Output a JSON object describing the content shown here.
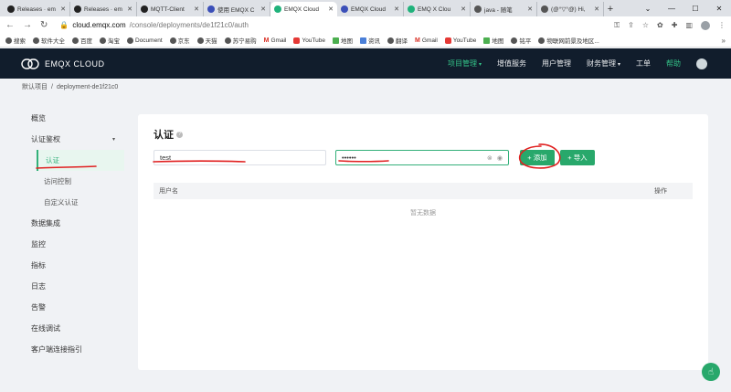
{
  "browser": {
    "tabs": [
      {
        "title": "Releases · em",
        "icon": "github-icon",
        "color": "#222222"
      },
      {
        "title": "Releases · em",
        "icon": "github-icon",
        "color": "#222222"
      },
      {
        "title": "MQTT-Client",
        "icon": "github-icon",
        "color": "#222222"
      },
      {
        "title": "使用 EMQX C",
        "icon": "document-icon",
        "color": "#3b4fb8"
      },
      {
        "title": "EMQX Cloud",
        "icon": "emqx-icon",
        "color": "#20b27b",
        "active": true
      },
      {
        "title": "EMQX Cloud",
        "icon": "document-icon",
        "color": "#3b4fb8"
      },
      {
        "title": "EMQ X Clou",
        "icon": "emqx-icon",
        "color": "#20b27b"
      },
      {
        "title": "java - 随笔",
        "icon": "blog-icon",
        "color": "#555555"
      },
      {
        "title": "(@°▽°@) Hi,",
        "icon": "blog-icon",
        "color": "#555555"
      }
    ],
    "close_glyph": "✕",
    "new_tab_glyph": "+",
    "url_domain": "cloud.emqx.com",
    "url_path": "/console/deployments/de1f21c0/auth",
    "bookmarks": [
      {
        "label": "搜索",
        "kind": "globe"
      },
      {
        "label": "软件大全",
        "kind": "globe"
      },
      {
        "label": "百度",
        "kind": "globe"
      },
      {
        "label": "淘宝",
        "kind": "globe"
      },
      {
        "label": "Document",
        "kind": "globe"
      },
      {
        "label": "京东",
        "kind": "globe"
      },
      {
        "label": "天猫",
        "kind": "globe"
      },
      {
        "label": "苏宁易购",
        "kind": "globe"
      },
      {
        "label": "Gmail",
        "kind": "gmail"
      },
      {
        "label": "YouTube",
        "kind": "youtube"
      },
      {
        "label": "地图",
        "kind": "map"
      },
      {
        "label": "资讯",
        "kind": "blue"
      },
      {
        "label": "翻译",
        "kind": "globe"
      },
      {
        "label": "Gmail",
        "kind": "gmail"
      },
      {
        "label": "YouTube",
        "kind": "youtube"
      },
      {
        "label": "地图",
        "kind": "map"
      },
      {
        "label": "铭平",
        "kind": "globe"
      },
      {
        "label": "物联网前景及地区...",
        "kind": "globe"
      }
    ]
  },
  "app": {
    "logo_text": "EMQX CLOUD",
    "nav": [
      {
        "label": "项目管理",
        "dropdown": true,
        "active": true
      },
      {
        "label": "增值服务",
        "dropdown": false
      },
      {
        "label": "用户管理",
        "dropdown": false
      },
      {
        "label": "财务管理",
        "dropdown": true
      },
      {
        "label": "工单",
        "dropdown": false
      },
      {
        "label": "帮助",
        "dropdown": false,
        "help": true
      }
    ],
    "breadcrumb": {
      "project": "默认项目",
      "separator": "/",
      "deployment": "deployment-de1f21c0"
    },
    "accent_color": "#28a86b"
  },
  "sidebar": {
    "items": [
      {
        "label": "概览",
        "level": 1
      },
      {
        "label": "认证鉴权",
        "level": 1,
        "expanded": true
      },
      {
        "label": "认证",
        "level": 2,
        "active": true
      },
      {
        "label": "访问控制",
        "level": 2
      },
      {
        "label": "自定义认证",
        "level": 2
      },
      {
        "label": "数据集成",
        "level": 1
      },
      {
        "label": "监控",
        "level": 1
      },
      {
        "label": "指标",
        "level": 1
      },
      {
        "label": "日志",
        "level": 1
      },
      {
        "label": "告警",
        "level": 1
      },
      {
        "label": "在线调试",
        "level": 1
      },
      {
        "label": "客户端连接指引",
        "level": 1
      }
    ]
  },
  "main": {
    "title": "认证",
    "username_value": "test",
    "password_value": "••••••",
    "add_label": "添加",
    "import_label": "导入",
    "table_headers": {
      "username": "用户名",
      "actions": "操作"
    },
    "empty_text": "暂无数据"
  }
}
